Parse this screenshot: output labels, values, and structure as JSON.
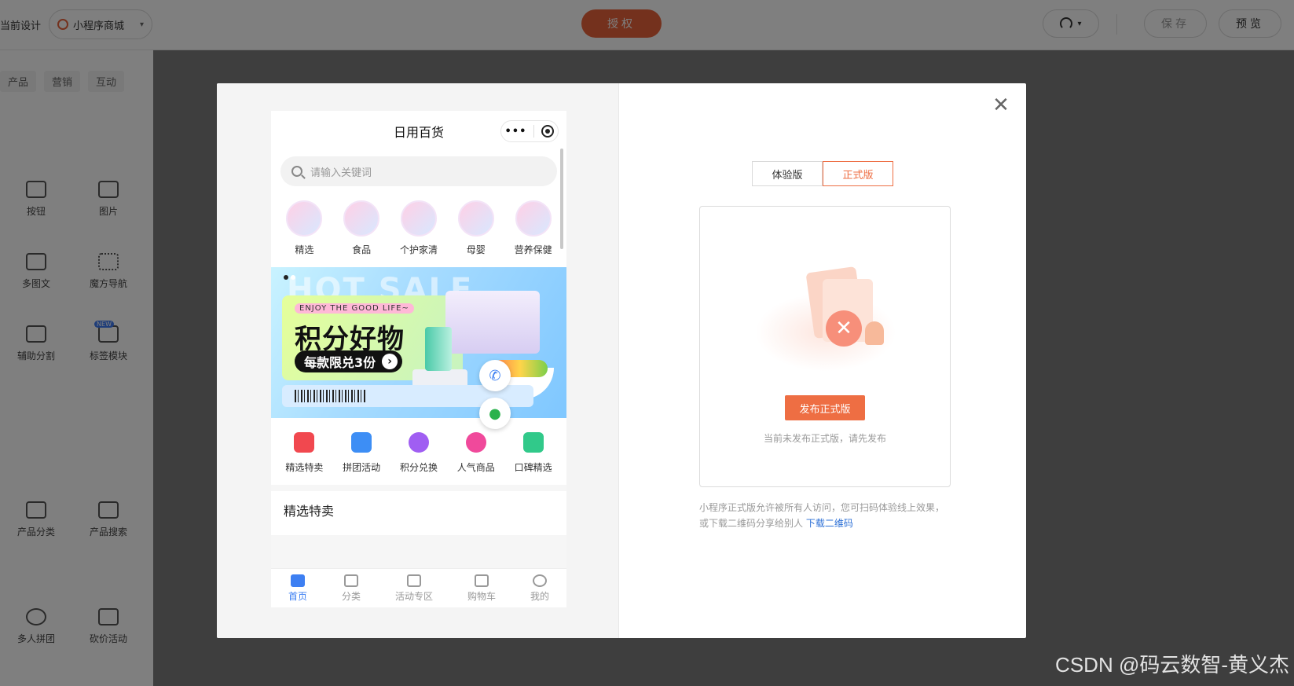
{
  "topbar": {
    "current_design_label": "当前设计",
    "project_name": "小程序商城",
    "auth_button": "授权",
    "save_button": "保存",
    "preview_button": "预览"
  },
  "sidebar": {
    "tabs": [
      "产品",
      "营销",
      "互动"
    ],
    "widgets": [
      {
        "label": "按钮",
        "icon": "button-icon"
      },
      {
        "label": "图片",
        "icon": "image-icon"
      },
      {
        "label": "多图文",
        "icon": "multi-image-text-icon"
      },
      {
        "label": "魔方导航",
        "icon": "grid-dots-icon"
      },
      {
        "label": "辅助分割",
        "icon": "divider-icon"
      },
      {
        "label": "标签模块",
        "icon": "tag-list-icon",
        "badge": "NEW"
      },
      {
        "label": "产品分类",
        "icon": "category-icon"
      },
      {
        "label": "产品搜索",
        "icon": "product-search-icon"
      },
      {
        "label": "多人拼团",
        "icon": "group-buy-icon"
      },
      {
        "label": "砍价活动",
        "icon": "bargain-tag-icon"
      }
    ]
  },
  "modal": {
    "phone": {
      "title": "日用百货",
      "search_placeholder": "请输入关键词",
      "categories": [
        "精选",
        "食品",
        "个护家清",
        "母婴",
        "营养保健"
      ],
      "banner": {
        "bg_text": "HOT SALE",
        "tagline": "ENJOY THE GOOD LIFE~",
        "headline": "积分好物",
        "pill": "每款限兑3份"
      },
      "quick_links": [
        {
          "label": "精选特卖",
          "color": "#f1484f"
        },
        {
          "label": "拼团活动",
          "color": "#3d8ef5"
        },
        {
          "label": "积分兑换",
          "color": "#a05ef2"
        },
        {
          "label": "人气商品",
          "color": "#f0499b"
        },
        {
          "label": "口碑精选",
          "color": "#31c98a"
        }
      ],
      "section_title": "精选特卖",
      "tabbar": [
        "首页",
        "分类",
        "活动专区",
        "购物车",
        "我的"
      ],
      "active_tab": "首页"
    },
    "versions": {
      "trial": "体验版",
      "release": "正式版",
      "active": "正式版"
    },
    "publish_button": "发布正式版",
    "not_published_hint": "当前未发布正式版，请先发布",
    "description": "小程序正式版允许被所有人访问，您可扫码体验线上效果，或下载二维码分享给别人",
    "download_link": "下载二维码"
  },
  "watermark": "CSDN @码云数智-黄义杰",
  "colors": {
    "accent": "#ee6e43",
    "link": "#2b6fd6",
    "phone_active": "#3d7ff2"
  }
}
